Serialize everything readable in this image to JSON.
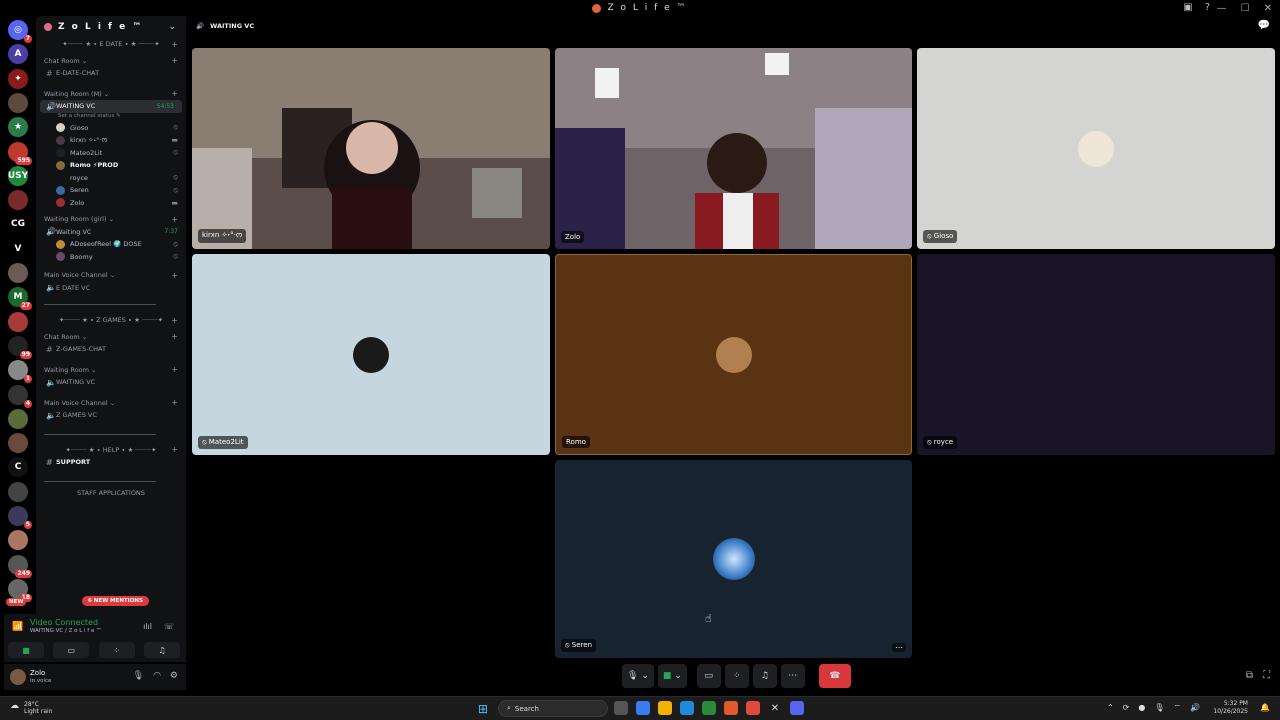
{
  "app": {
    "title": "Z o L i f e ™"
  },
  "header": {
    "channel": "WAITING VC"
  },
  "rail": {
    "servers": [
      {
        "label": "◎",
        "badge": "7",
        "color": "#5865f2"
      },
      {
        "label": "A",
        "badge": "",
        "color": "#4b3fa6"
      },
      {
        "label": "✦",
        "badge": "",
        "color": "#8b1a1a"
      },
      {
        "label": "",
        "badge": "",
        "color": "#5c4a3c"
      },
      {
        "label": "★",
        "badge": "",
        "color": "#2d7a4a"
      },
      {
        "label": "",
        "badge": "595",
        "color": "#c0392b"
      },
      {
        "label": "USY",
        "badge": "",
        "color": "#1f8b3a"
      },
      {
        "label": "",
        "badge": "",
        "color": "#7a2a2a"
      },
      {
        "label": "CG",
        "badge": "",
        "color": "#000000"
      },
      {
        "label": "V",
        "badge": "",
        "color": "#000000"
      },
      {
        "label": "",
        "badge": "",
        "color": "#6b5a55"
      },
      {
        "label": "M",
        "badge": "27",
        "color": "#1a6b2a"
      },
      {
        "label": "",
        "badge": "",
        "color": "#a83a3a"
      },
      {
        "label": "",
        "badge": "99",
        "color": "#222222"
      },
      {
        "label": "",
        "badge": "1",
        "color": "#888888"
      },
      {
        "label": "",
        "badge": "4",
        "color": "#333333"
      },
      {
        "label": "",
        "badge": "",
        "color": "#5a6a3a"
      },
      {
        "label": "",
        "badge": "",
        "color": "#6a4a3a"
      },
      {
        "label": "C",
        "badge": "",
        "color": "#111111"
      },
      {
        "label": "",
        "badge": "",
        "color": "#444444"
      },
      {
        "label": "",
        "badge": "5",
        "color": "#3a3a5a"
      },
      {
        "label": "",
        "badge": "",
        "color": "#aa7766"
      },
      {
        "label": "",
        "badge": "249",
        "color": "#555555"
      },
      {
        "label": "",
        "badge": "18",
        "color": "#666666"
      }
    ],
    "new_badge": "NEW"
  },
  "sidebar": {
    "server_name": "Z o L i f e ™",
    "categories": {
      "edate": "✦┈┈┈┈ ★ ∙ E DATE ∙ ★ ┈┈┈┈✦",
      "chat_room": "Chat Room",
      "waiting_room_m": "Waiting Room (M)",
      "waiting_room_girl": "Waiting Room (girl)",
      "main_voice": "Main Voice Channel",
      "zgames": "✦┈┈┈┈ ★ ∙ Z GAMES ∙ ★ ┈┈┈┈✦",
      "chat_room_2": "Chat Room",
      "waiting_room_2": "Waiting Room",
      "main_voice_2": "Main Voice Channel",
      "help": "✦┈┈┈┈ ★ ∙ HELP ∙ ★ ┈┈┈┈✦",
      "staff": "STAFF APPLICATIONS"
    },
    "channels": {
      "edate_chat": "E-DATE-CHAT",
      "waiting_vc": "WAITING VC",
      "waiting_vc_timer": "54:53",
      "status_hint": "Set a channel status ✎",
      "waiting_vc_girl": "Waiting VC",
      "waiting_vc_girl_timer": "7:37",
      "edate_vc": "E DATE VC",
      "zgames_chat": "Z-GAMES-CHAT",
      "waiting_vc_2": "WAITING VC",
      "zgames_vc": "Z GAMES VC",
      "support": "SUPPORT"
    },
    "users_m": [
      "Gioso",
      "kirxn ✧˖°·ᰔ",
      "Mateo2Lit",
      "Romo ⚡PROD",
      "royce",
      "Seren",
      "Zolo"
    ],
    "users_girl": [
      "ADoseofReel 🌍 DOSE",
      "Boomy"
    ],
    "mentions": "6 NEW MENTIONS"
  },
  "voice_panel": {
    "title": "Video Connected",
    "subtitle": "WAITING VC / Z o L i f e ™"
  },
  "user_panel": {
    "name": "Zolo",
    "status": "In voice"
  },
  "tiles": [
    {
      "name": "kirxn ✧˖°·ᰔ",
      "color": "#6a5a55"
    },
    {
      "name": "Zolo",
      "color": "#4a4048"
    },
    {
      "name": "Gioso",
      "color": "#d4d4d2"
    },
    {
      "name": "Mateo2Lit",
      "color": "#c5d6de"
    },
    {
      "name": "Romo",
      "color": "#5a3312"
    },
    {
      "name": "royce",
      "color": "#1a1526"
    },
    {
      "name": "Seren",
      "color": "#17242f"
    }
  ],
  "taskbar": {
    "weather_temp": "28°C",
    "weather_desc": "Light rain",
    "search": "Search",
    "time": "5:32 PM",
    "date": "10/26/2025"
  }
}
